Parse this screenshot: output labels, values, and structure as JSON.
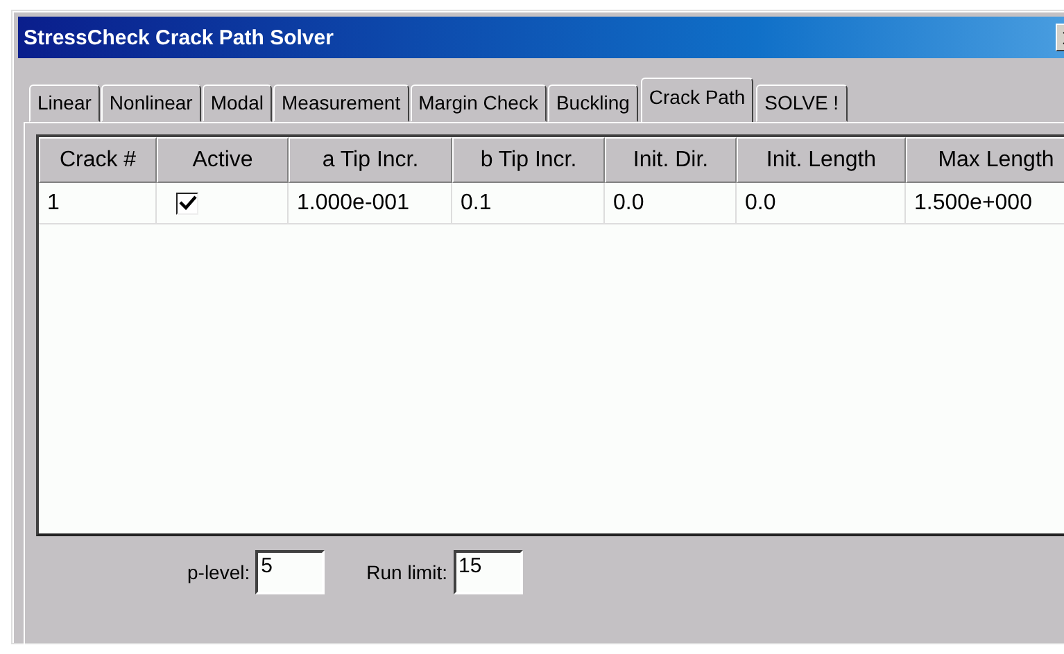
{
  "window": {
    "title": "StressCheck Crack Path Solver"
  },
  "tabs": [
    {
      "label": "Linear",
      "selected": false
    },
    {
      "label": "Nonlinear",
      "selected": false
    },
    {
      "label": "Modal",
      "selected": false
    },
    {
      "label": "Measurement",
      "selected": false
    },
    {
      "label": "Margin Check",
      "selected": false
    },
    {
      "label": "Buckling",
      "selected": false
    },
    {
      "label": "Crack Path",
      "selected": true
    },
    {
      "label": "SOLVE !",
      "selected": false
    }
  ],
  "table": {
    "columns": [
      "Crack #",
      "Active",
      "a Tip Incr.",
      "b Tip Incr.",
      "Init. Dir.",
      "Init. Length",
      "Max Length"
    ],
    "rows": [
      {
        "crack": "1",
        "active": true,
        "a_tip_incr": "1.000e-001",
        "b_tip_incr": "0.1",
        "init_dir": "0.0",
        "init_length": "0.0",
        "max_length": "1.500e+000"
      }
    ]
  },
  "fields": [
    {
      "label": "p-level:",
      "value": "5"
    },
    {
      "label": "Run limit:",
      "value": "15"
    }
  ]
}
